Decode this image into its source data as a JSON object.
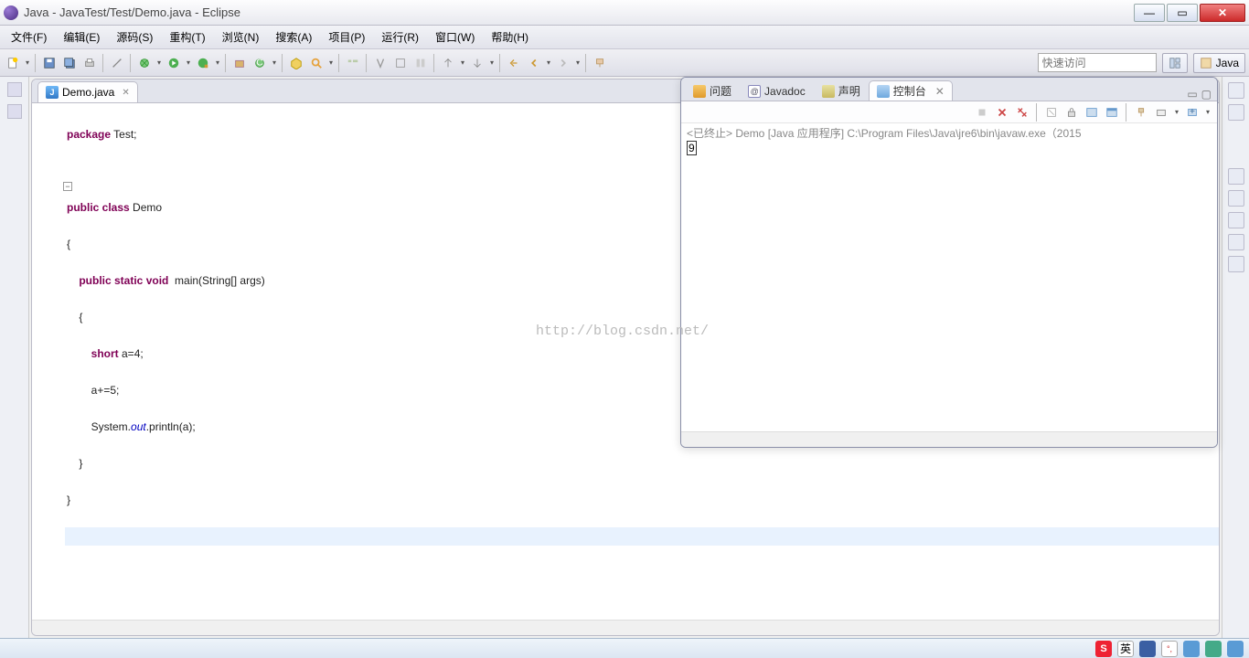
{
  "window": {
    "title": "Java - JavaTest/Test/Demo.java - Eclipse"
  },
  "menu": {
    "items": [
      "文件(F)",
      "编辑(E)",
      "源码(S)",
      "重构(T)",
      "浏览(N)",
      "搜索(A)",
      "项目(P)",
      "运行(R)",
      "窗口(W)",
      "帮助(H)"
    ]
  },
  "toolbar": {
    "quick_access_placeholder": "快速访问",
    "perspective_label": "Java"
  },
  "editor": {
    "tab_label": "Demo.java",
    "code": {
      "l1a": "package",
      "l1b": " Test;",
      "l2a": "public",
      "l2b": " class",
      "l2c": " Demo",
      "l3": "{",
      "l4a": "    public",
      "l4b": " static",
      "l4c": " void",
      "l4d": "  main(String[] args)",
      "l5": "    {",
      "l6a": "        short",
      "l6b": " a=4;",
      "l7": "        a+=5;",
      "l8a": "        System.",
      "l8b": "out",
      "l8c": ".println(a);",
      "l9": "    }",
      "l10": "}"
    }
  },
  "console_tabs": {
    "problems": "问题",
    "javadoc": "Javadoc",
    "declaration": "声明",
    "console": "控制台"
  },
  "console": {
    "header": "<已终止> Demo [Java 应用程序] C:\\Program Files\\Java\\jre6\\bin\\javaw.exe（2015",
    "output": "9"
  },
  "watermark": "http://blog.csdn.net/",
  "status": {
    "ime": "英"
  }
}
